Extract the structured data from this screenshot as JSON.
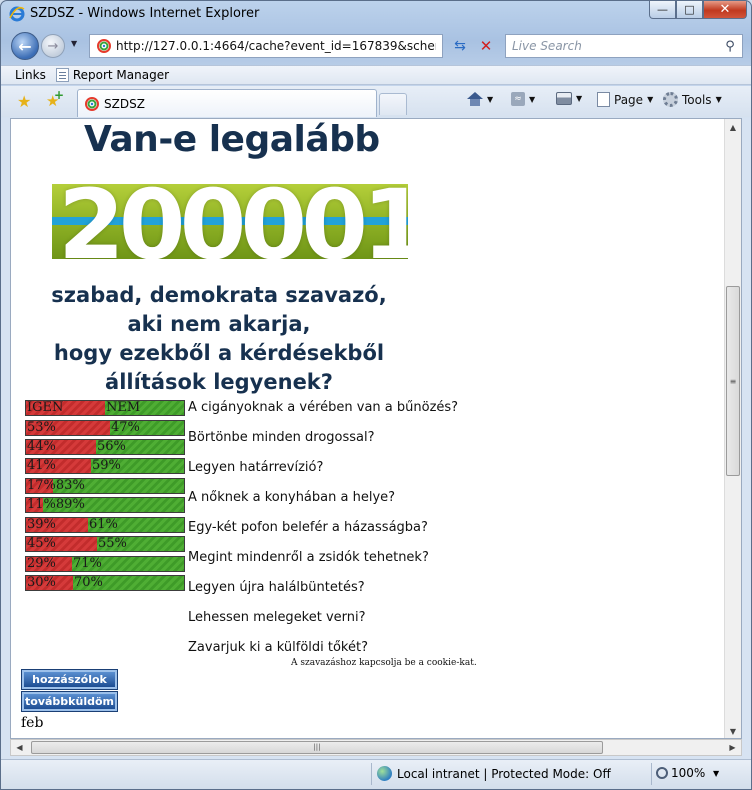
{
  "window": {
    "title": "SZDSZ - Windows Internet Explorer"
  },
  "nav": {
    "address": "http://127.0.0.1:4664/cache?event_id=167839&schema_id=2",
    "search_placeholder": "Live Search"
  },
  "links_bar": {
    "label": "Links",
    "items": [
      {
        "label": "Report Manager"
      }
    ]
  },
  "tabs": [
    {
      "label": "SZDSZ"
    }
  ],
  "command_bar": {
    "page_label": "Page",
    "tools_label": "Tools"
  },
  "page": {
    "headline": "Van-e legalább",
    "banner_number": "200001",
    "subtitle_lines": [
      "szabad, demokrata szavazó,",
      "aki nem akarja,",
      "hogy ezekből a kérdésekből",
      "állítások legyenek?"
    ],
    "poll": [
      {
        "yes_label": "IGEN",
        "no_label": "NEM",
        "yes_pct": 50,
        "question": "A cigányoknak a vérében van a bűnözés?"
      },
      {
        "yes_label": "53%",
        "no_label": "47%",
        "yes_pct": 53,
        "question": "Börtönbe minden drogossal?"
      },
      {
        "yes_label": "44%",
        "no_label": "56%",
        "yes_pct": 44,
        "question": "Legyen határrevízió?"
      },
      {
        "yes_label": "41%",
        "no_label": "59%",
        "yes_pct": 41,
        "question": "A nőknek a konyhában a helye?"
      },
      {
        "yes_label": "17%",
        "no_label": "83%",
        "yes_pct": 17,
        "question": "Egy-két pofon belefér a házasságba?"
      },
      {
        "yes_label": "11%",
        "no_label": "89%",
        "yes_pct": 11,
        "question": "Megint mindenről a zsidók tehetnek?"
      },
      {
        "yes_label": "39%",
        "no_label": "61%",
        "yes_pct": 39,
        "question": "Legyen újra halálbüntetés?"
      },
      {
        "yes_label": "45%",
        "no_label": "55%",
        "yes_pct": 45,
        "question": "Lehessen melegeket verni?"
      },
      {
        "yes_label": "29%",
        "no_label": "71%",
        "yes_pct": 29,
        "question": "Zavarjuk ki a külföldi tőkét?"
      },
      {
        "yes_label": "30%",
        "no_label": "70%",
        "yes_pct": 30,
        "question": ""
      }
    ],
    "cookie_note": "A szavazáshoz kapcsolja be a cookie-kat.",
    "comment_button": "hozzászólok",
    "forward_button": "továbbküldöm",
    "footer_text": "feb"
  },
  "status": {
    "zone": "Local intranet | Protected Mode: Off",
    "zoom": "100%"
  }
}
